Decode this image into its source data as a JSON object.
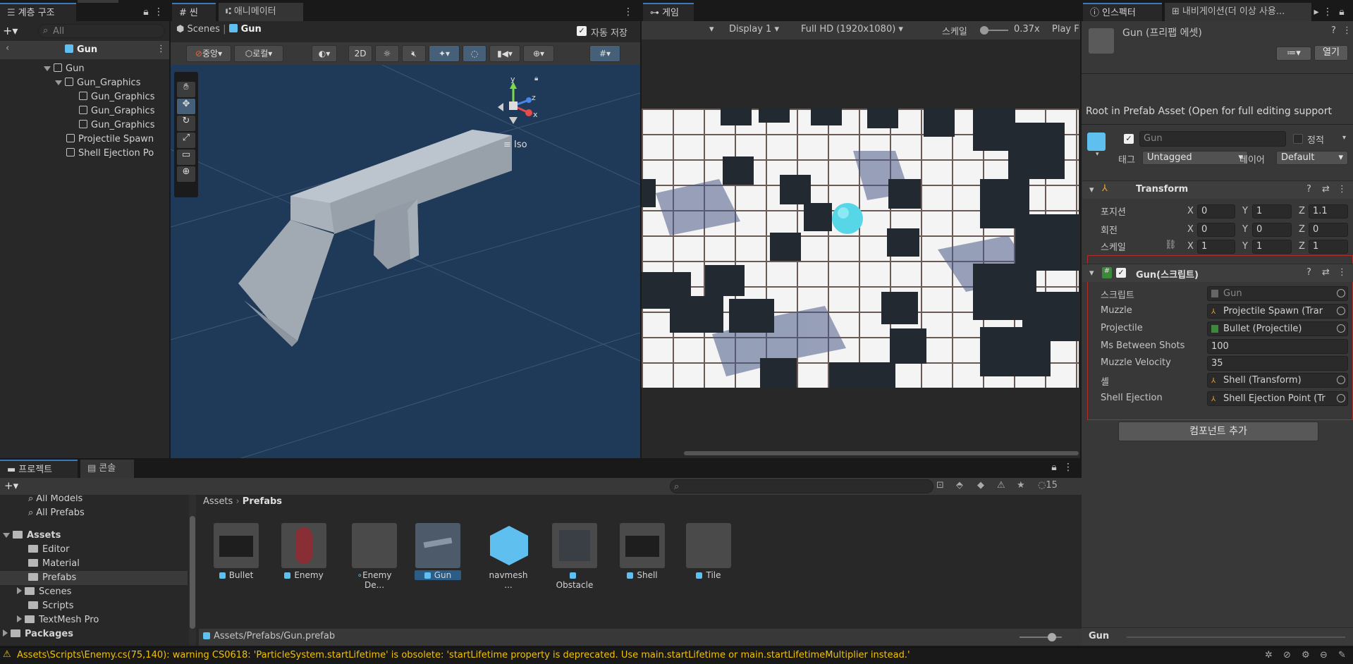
{
  "hierarchy": {
    "tab": "계층 구조",
    "search_placeholder": "All",
    "breadcrumb": "Gun",
    "items": [
      {
        "label": "Gun"
      },
      {
        "label": "Gun_Graphics"
      },
      {
        "label": "Gun_Graphics"
      },
      {
        "label": "Gun_Graphics"
      },
      {
        "label": "Gun_Graphics"
      },
      {
        "label": "Projectile Spawn"
      },
      {
        "label": "Shell Ejection Po"
      }
    ]
  },
  "scene": {
    "tab_scene": "씬",
    "tab_animator": "애니메이터",
    "breadcrumb_root": "Scenes",
    "breadcrumb_current": "Gun",
    "autosave_label": "자동 저장",
    "pivot_label": "중앙",
    "space_label": "로컬",
    "mode_2d": "2D",
    "projection": "Iso",
    "gizmo_x": "x",
    "gizmo_y": "y",
    "gizmo_z": "z"
  },
  "game": {
    "tab": "게임",
    "display": "Display 1",
    "resolution": "Full HD (1920x1080)",
    "scale_label": "스케일",
    "scale_value": "0.37x",
    "play_label": "Play F"
  },
  "inspector": {
    "tab": "인스펙터",
    "tab_nav": "내비게이션(더 이상 사용...",
    "asset_title": "Gun (프리팹 에셋)",
    "open_button": "열기",
    "root_notice": "Root in Prefab Asset (Open for full editing support",
    "name_value": "Gun",
    "static_label": "정적",
    "tag_label": "태그",
    "tag_value": "Untagged",
    "layer_label": "레이어",
    "layer_value": "Default",
    "transform": {
      "title": "Transform",
      "position_label": "포지션",
      "rotation_label": "회전",
      "scale_label": "스케일",
      "position": {
        "x": "0",
        "y": "1",
        "z": "1.1"
      },
      "rotation": {
        "x": "0",
        "y": "0",
        "z": "0"
      },
      "scale": {
        "x": "1",
        "y": "1",
        "z": "1"
      }
    },
    "gun_script": {
      "title": "Gun(스크립트)",
      "script_label": "스크립트",
      "script_value": "Gun",
      "muzzle_label": "Muzzle",
      "muzzle_value": "Projectile Spawn (Trar",
      "projectile_label": "Projectile",
      "projectile_value": "Bullet (Projectile)",
      "ms_label": "Ms Between Shots",
      "ms_value": "100",
      "velocity_label": "Muzzle Velocity",
      "velocity_value": "35",
      "shell_label": "셸",
      "shell_value": "Shell (Transform)",
      "ejection_label": "Shell Ejection",
      "ejection_value": "Shell Ejection Point (Tr"
    },
    "add_component": "컴포넌트 추가",
    "footer_label": "Gun"
  },
  "project": {
    "tab_project": "프로젝트",
    "tab_console": "콘솔",
    "hidden_count": "15",
    "tree": [
      {
        "label": "All Models"
      },
      {
        "label": "All Prefabs"
      },
      {
        "label": "Assets"
      },
      {
        "label": "Editor"
      },
      {
        "label": "Material"
      },
      {
        "label": "Prefabs"
      },
      {
        "label": "Scenes"
      },
      {
        "label": "Scripts"
      },
      {
        "label": "TextMesh Pro"
      },
      {
        "label": "Packages"
      }
    ],
    "breadcrumb_root": "Assets",
    "breadcrumb_current": "Prefabs",
    "assets": [
      {
        "label": "Bullet"
      },
      {
        "label": "Enemy"
      },
      {
        "label": "Enemy De..."
      },
      {
        "label": "Gun"
      },
      {
        "label": "navmesh ..."
      },
      {
        "label": "Obstacle"
      },
      {
        "label": "Shell"
      },
      {
        "label": "Tile"
      }
    ],
    "path": "Assets/Prefabs/Gun.prefab"
  },
  "status": {
    "warning": "Assets\\Scripts\\Enemy.cs(75,140): warning CS0618: 'ParticleSystem.startLifetime' is obsolete: 'startLifetime property is deprecated. Use main.startLifetime or main.startLifetimeMultiplier instead.'"
  }
}
